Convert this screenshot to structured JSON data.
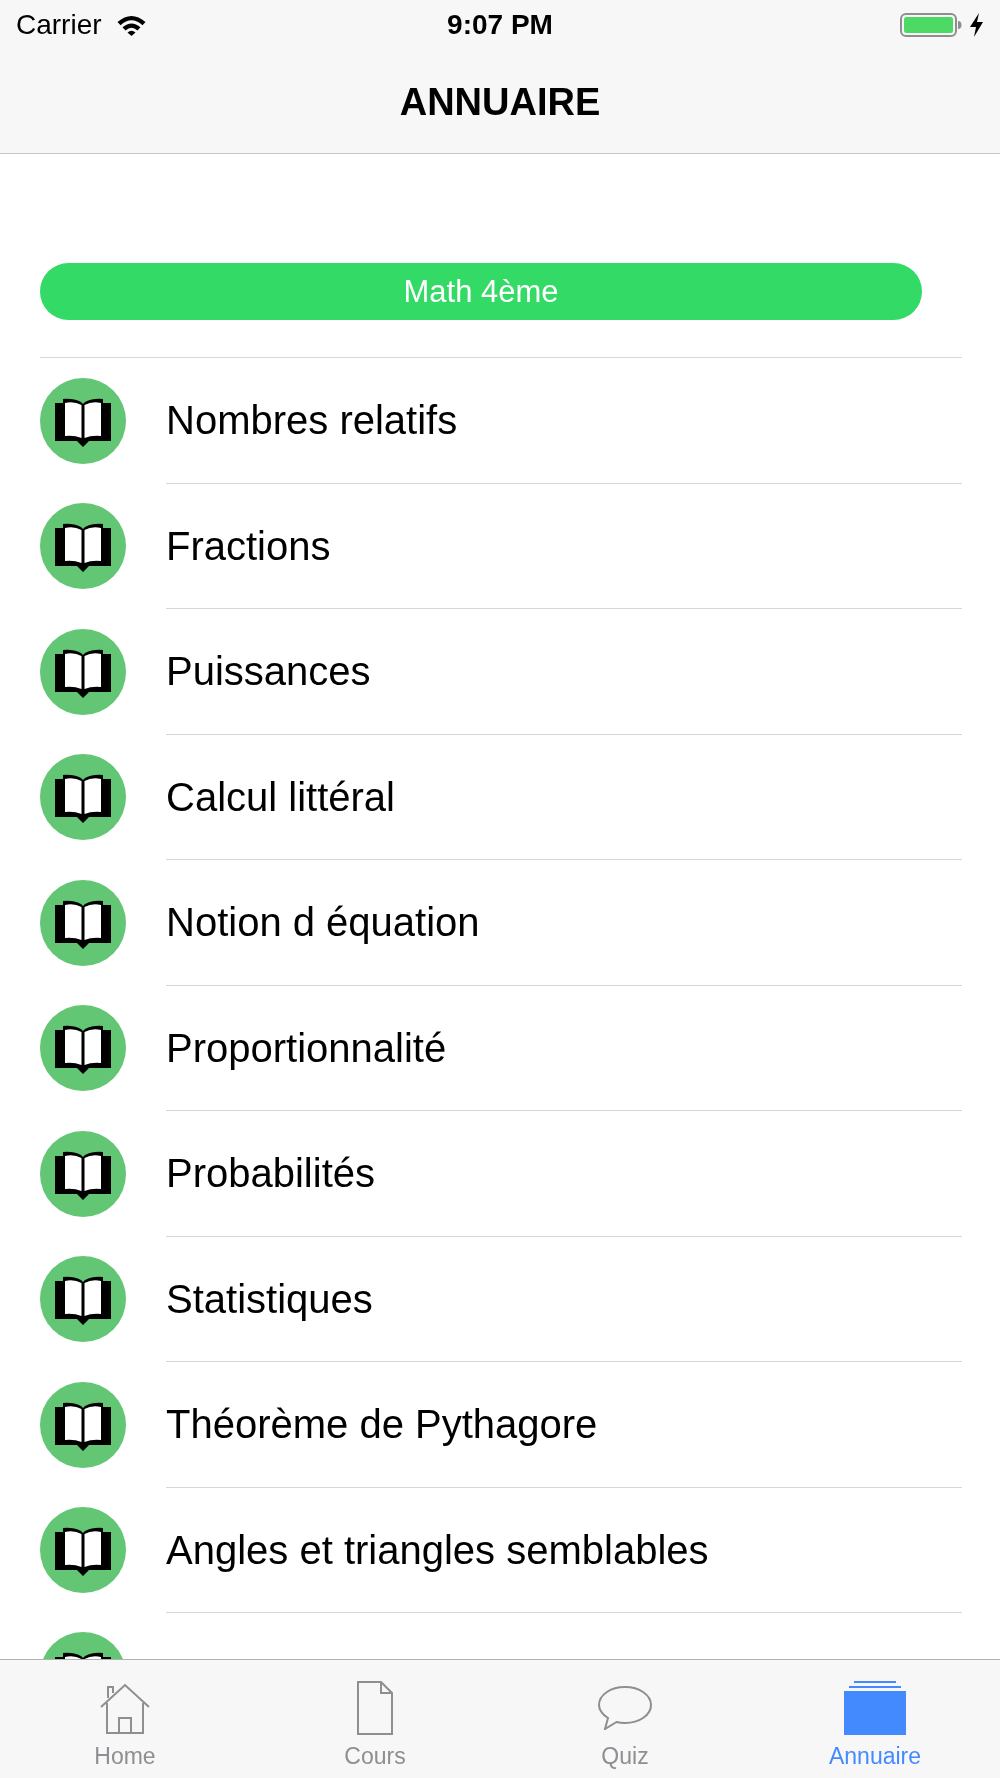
{
  "status_bar": {
    "carrier": "Carrier",
    "time": "9:07 PM"
  },
  "nav_bar": {
    "title": "ANNUAIRE"
  },
  "level_button": {
    "label": "Math 4ème"
  },
  "chapters": [
    {
      "kind": "topic",
      "label": "Nombres relatifs"
    },
    {
      "kind": "topic",
      "label": "Fractions"
    },
    {
      "kind": "topic",
      "label": "Puissances"
    },
    {
      "kind": "topic",
      "label": "Calcul littéral"
    },
    {
      "kind": "topic",
      "label": "Notion d équation"
    },
    {
      "kind": "topic",
      "label": "Proportionnalité"
    },
    {
      "kind": "topic",
      "label": "Probabilités"
    },
    {
      "kind": "topic",
      "label": "Statistiques"
    },
    {
      "kind": "topic",
      "label": "Théorème de Pythagore"
    },
    {
      "kind": "topic",
      "label": "Angles et triangles semblables"
    },
    {
      "kind": "cut_off"
    }
  ],
  "tab_bar": [
    {
      "label": "Home",
      "selected": false
    },
    {
      "label": "Cours",
      "selected": false
    },
    {
      "label": "Quiz",
      "selected": false
    },
    {
      "label": "Annuaire",
      "selected": true
    }
  ]
}
